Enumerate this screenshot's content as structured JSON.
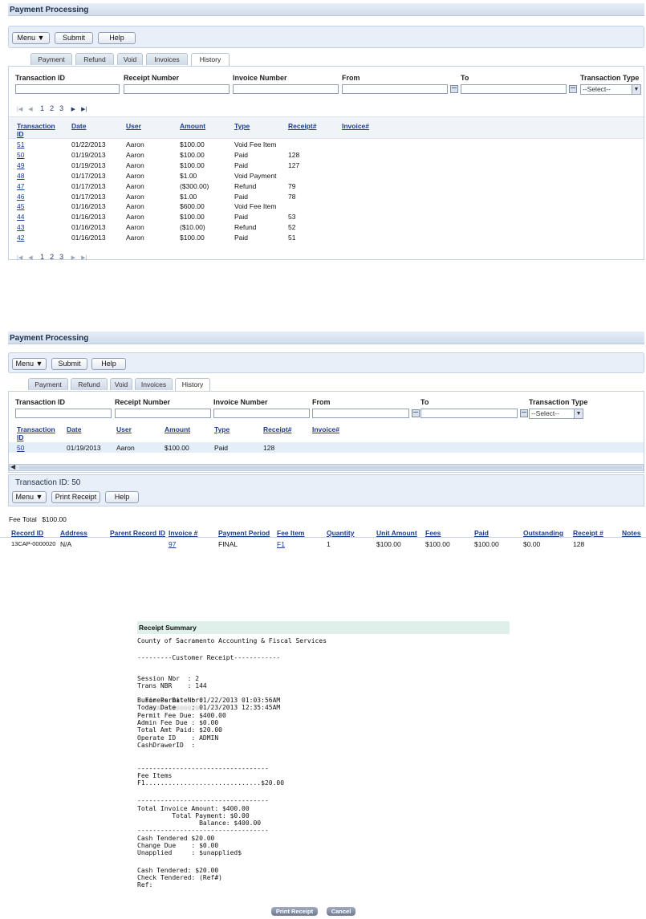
{
  "screen1": {
    "title": "Payment Processing",
    "toolbar": {
      "menu": "Menu ▼",
      "submit": "Submit",
      "help": "Help"
    },
    "tabs": [
      "Payment",
      "Refund",
      "Void",
      "Invoices",
      "History"
    ],
    "filters": {
      "transaction_id": "Transaction ID",
      "receipt_number": "Receipt Number",
      "invoice_number": "Invoice Number",
      "from": "From",
      "to": "To",
      "transaction_type": "Transaction Type",
      "select_value": "--Select--"
    },
    "pager": [
      "1",
      "2",
      "3"
    ],
    "columns": [
      "Transaction ID",
      "Date",
      "User",
      "Amount",
      "Type",
      "Receipt#",
      "Invoice#"
    ],
    "rows": [
      [
        "51",
        "01/22/2013",
        "Aaron",
        "$100.00",
        "Void Fee Item",
        ""
      ],
      [
        "50",
        "01/19/2013",
        "Aaron",
        "$100.00",
        "Paid",
        "128"
      ],
      [
        "49",
        "01/19/2013",
        "Aaron",
        "$100.00",
        "Paid",
        "127"
      ],
      [
        "48",
        "01/17/2013",
        "Aaron",
        "$1.00",
        "Void Payment",
        ""
      ],
      [
        "47",
        "01/17/2013",
        "Aaron",
        "($300.00)",
        "Refund",
        "79"
      ],
      [
        "46",
        "01/17/2013",
        "Aaron",
        "$1.00",
        "Paid",
        "78"
      ],
      [
        "45",
        "01/16/2013",
        "Aaron",
        "$600.00",
        "Void Fee Item",
        ""
      ],
      [
        "44",
        "01/16/2013",
        "Aaron",
        "$100.00",
        "Paid",
        "53"
      ],
      [
        "43",
        "01/16/2013",
        "Aaron",
        "($10.00)",
        "Refund",
        "52"
      ],
      [
        "42",
        "01/16/2013",
        "Aaron",
        "$100.00",
        "Paid",
        "51"
      ]
    ]
  },
  "screen2": {
    "title": "Payment Processing",
    "toolbar": {
      "menu": "Menu ▼",
      "submit": "Submit",
      "help": "Help"
    },
    "tabs": [
      "Payment",
      "Refund",
      "Void",
      "Invoices",
      "History"
    ],
    "filters": {
      "transaction_id": "Transaction ID",
      "receipt_number": "Receipt Number",
      "invoice_number": "Invoice Number",
      "from": "From",
      "to": "To",
      "transaction_type": "Transaction Type",
      "select_value": "--Select--"
    },
    "columns": [
      "Transaction ID",
      "Date",
      "User",
      "Amount",
      "Type",
      "Receipt#",
      "Invoice#"
    ],
    "row": [
      "50",
      "01/19/2013",
      "Aaron",
      "$100.00",
      "Paid",
      "128"
    ],
    "detail_title": "Transaction ID: 50",
    "detail_toolbar": {
      "menu": "Menu ▼",
      "print_receipt": "Print Receipt",
      "help": "Help"
    },
    "fee_total_label": "Fee Total",
    "fee_total_value": "$100.00",
    "fee_columns": [
      "Record ID",
      "Address",
      "Parent Record ID",
      "Invoice #",
      "Payment Period",
      "Fee Item",
      "Quantity",
      "Unit Amount",
      "Fees",
      "Paid",
      "Outstanding",
      "Receipt #",
      "Notes"
    ],
    "fee_row": [
      "13CAP-0000020",
      "N/A",
      "",
      "97",
      "FINAL",
      "F1",
      "1",
      "$100.00",
      "$100.00",
      "$100.00",
      "$0.00",
      "128",
      ""
    ]
  },
  "receipt": {
    "title": "Receipt Summary",
    "org": "County of Sacramento Accounting & Fiscal Services",
    "customer_header": "---------Customer Receipt------------",
    "lines_a": [
      "Session Nbr  : 2",
      "Trans NBR    : 144"
    ],
    "permit_label": "For Permit Nbr:",
    "permit_value": "13CAP-00000020",
    "lines_b": [
      "Business Date : 01/22/2013 01:03:56AM",
      "Today Date    : 01/23/2013 12:35:45AM",
      "Permit Fee Due: $400.00",
      "Admin Fee Due : $0.00",
      "Total Amt Paid: $20.00",
      "Operate ID    : ADMIN",
      "CashDrawerID  :"
    ],
    "sep1": "----------------------------------",
    "fee_items_label": "Fee Items",
    "fee_item_line": "F1..............................$20.00",
    "sep2": "----------------------------------",
    "totals": [
      "Total Invoice Amount: $400.00",
      "         Total Payment: $0.00",
      "                Balance: $400.00"
    ],
    "sep3": "----------------------------------",
    "tender": [
      "Cash Tendered $20.00",
      "Change Due    : $0.00",
      "Unapplied     : $unapplied$"
    ],
    "tender2": [
      "Cash Tendered: $20.00",
      "Check Tendered: (Ref#)",
      "Ref:"
    ],
    "print_button": "Print Receipt",
    "cancel_button": "Cancel"
  }
}
